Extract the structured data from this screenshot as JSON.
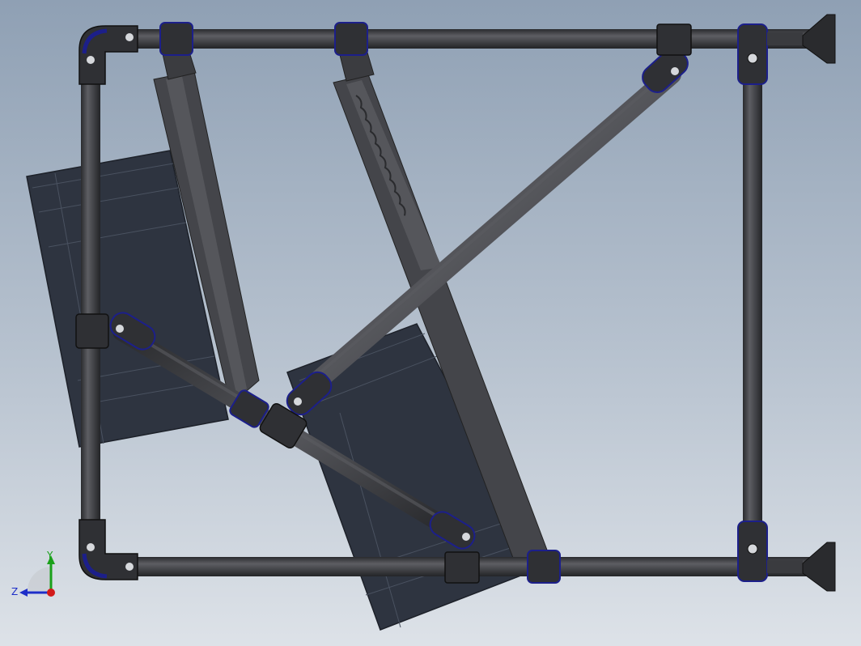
{
  "viewport": {
    "background_top": "#8fa0b4",
    "background_bottom": "#dde2e8"
  },
  "colors": {
    "tube": "#3a3b3f",
    "tube_highlight": "#5b5c61",
    "fitting": "#2f3034",
    "fitting_accent": "#1c1f8a",
    "panel": "#2e3440",
    "panel_line": "#4a5260",
    "rail": "#44454a"
  },
  "triad": {
    "y_label": "Y",
    "z_label": "Z",
    "icon": "view-orientation-triad-icon"
  }
}
